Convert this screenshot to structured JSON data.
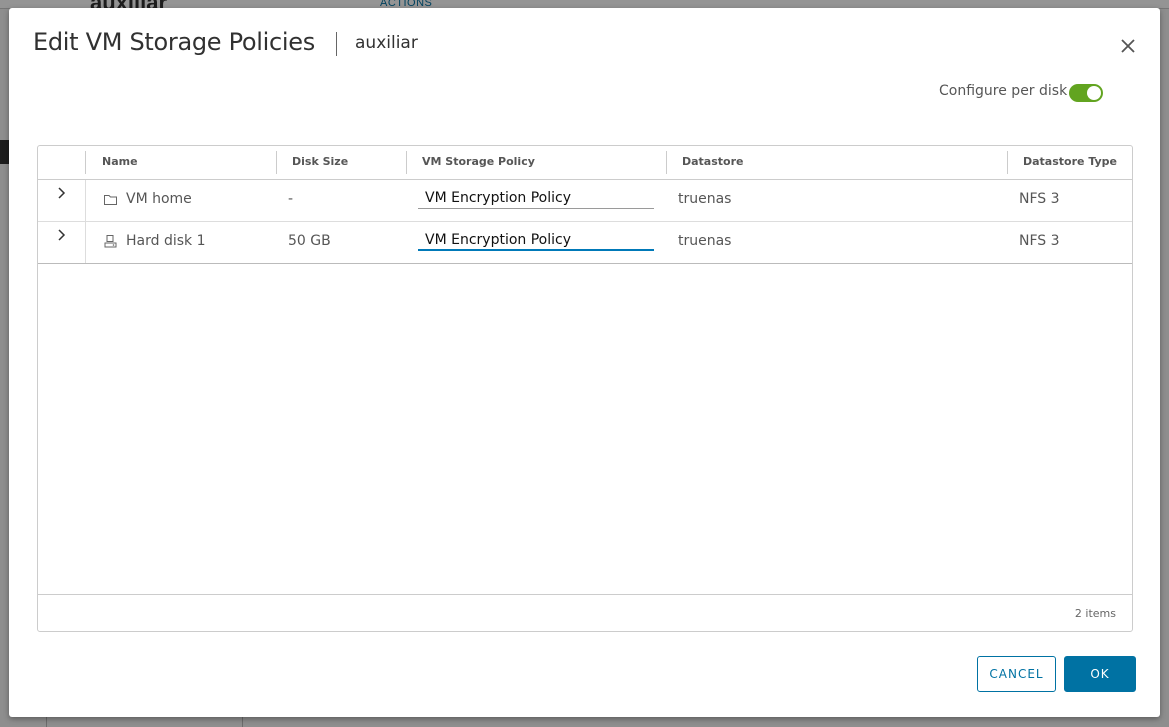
{
  "background": {
    "title": "auxiliar",
    "actions_label": "ACTIONS"
  },
  "dialog": {
    "title": "Edit VM Storage Policies",
    "subtitle": "auxiliar",
    "close_icon": "close-icon",
    "configure_per_disk": {
      "label": "Configure per disk",
      "enabled": true,
      "accent": "#62a420"
    },
    "grid": {
      "columns": [
        "Name",
        "Disk Size",
        "VM Storage Policy",
        "Datastore",
        "Datastore Type"
      ],
      "rows": [
        {
          "icon": "folder-icon",
          "name": "VM home",
          "disk_size": "-",
          "policy": "VM Encryption Policy",
          "datastore": "truenas",
          "datastore_type": "NFS 3"
        },
        {
          "icon": "hard-disk-icon",
          "name": "Hard disk 1",
          "disk_size": "50 GB",
          "policy": "VM Encryption Policy",
          "datastore": "truenas",
          "datastore_type": "NFS 3"
        }
      ],
      "footer": "2 items"
    },
    "buttons": {
      "cancel": "CANCEL",
      "ok": "OK",
      "primary_color": "#0072a3"
    }
  }
}
